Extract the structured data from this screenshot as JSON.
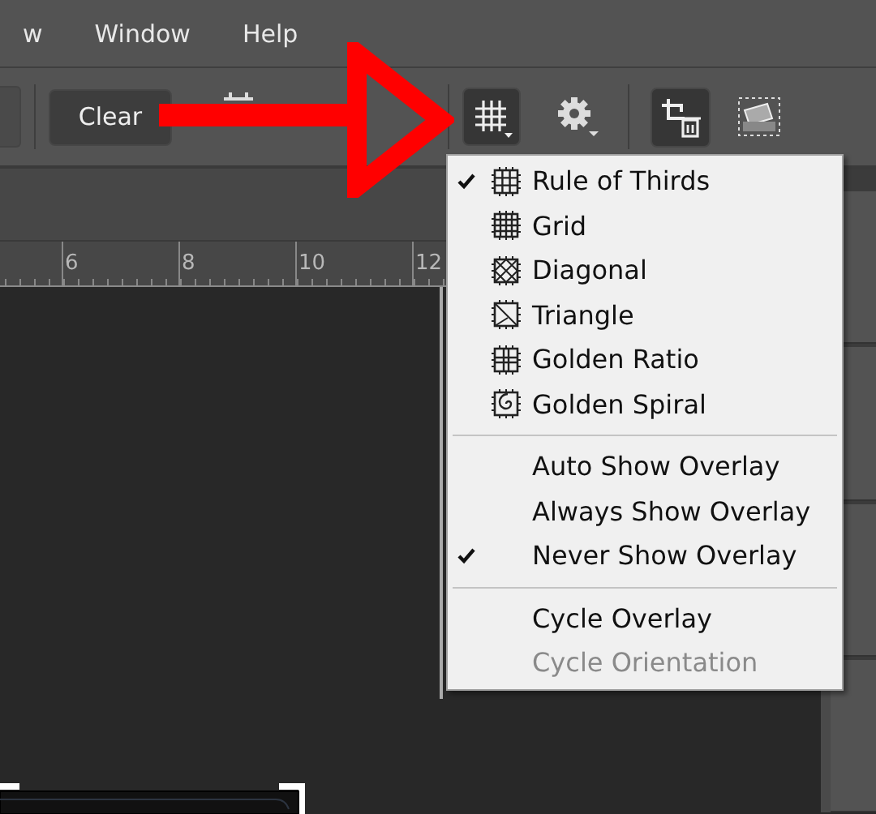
{
  "menubar": {
    "items": [
      "w",
      "Window",
      "Help"
    ]
  },
  "toolbar": {
    "clear_button": "Clear",
    "overlay_button": {
      "pressed": true
    }
  },
  "ruler": {
    "labels": [
      "6",
      "8",
      "10",
      "12"
    ]
  },
  "overlay_menu": {
    "groups": [
      [
        {
          "kind": "rule-of-thirds",
          "label": "Rule of Thirds",
          "checked": true,
          "disabled": false
        },
        {
          "kind": "grid",
          "label": "Grid",
          "checked": false,
          "disabled": false
        },
        {
          "kind": "diagonal",
          "label": "Diagonal",
          "checked": false,
          "disabled": false
        },
        {
          "kind": "triangle",
          "label": "Triangle",
          "checked": false,
          "disabled": false
        },
        {
          "kind": "golden-ratio",
          "label": "Golden Ratio",
          "checked": false,
          "disabled": false
        },
        {
          "kind": "golden-spiral",
          "label": "Golden Spiral",
          "checked": false,
          "disabled": false
        }
      ],
      [
        {
          "kind": "plain",
          "label": "Auto Show Overlay",
          "checked": false,
          "disabled": false
        },
        {
          "kind": "plain",
          "label": "Always Show Overlay",
          "checked": false,
          "disabled": false
        },
        {
          "kind": "plain",
          "label": "Never Show Overlay",
          "checked": true,
          "disabled": false
        }
      ],
      [
        {
          "kind": "plain",
          "label": "Cycle Overlay",
          "checked": false,
          "disabled": false
        },
        {
          "kind": "plain",
          "label": "Cycle Orientation",
          "checked": false,
          "disabled": true
        }
      ]
    ]
  }
}
